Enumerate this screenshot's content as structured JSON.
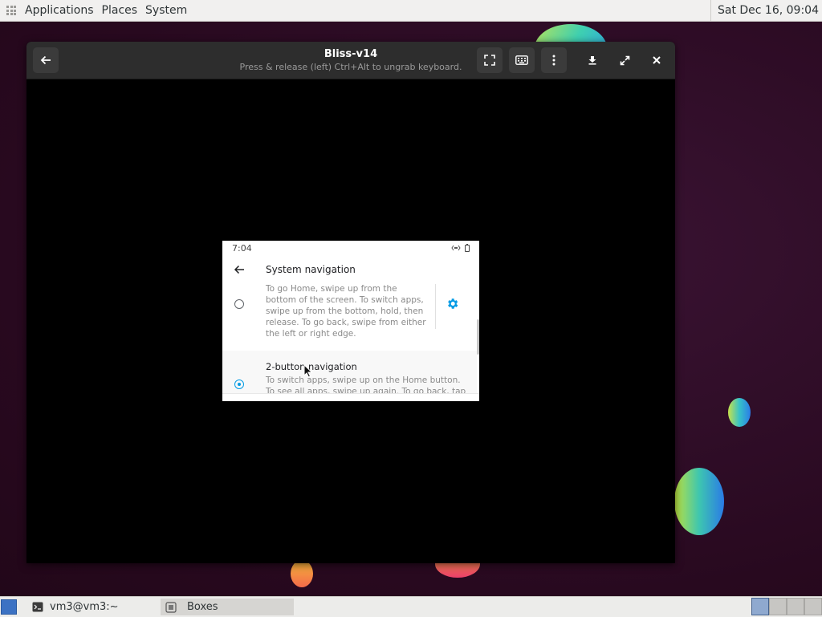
{
  "top_panel": {
    "menus": [
      "Applications",
      "Places",
      "System"
    ],
    "clock": "Sat Dec 16, 09:04"
  },
  "window": {
    "title": "Bliss-v14",
    "subtitle": "Press & release (left) Ctrl+Alt to ungrab keyboard.",
    "icons": {
      "back": "back-arrow-icon",
      "fullscreen": "fullscreen-icon",
      "keyboard": "keyboard-icon",
      "menu": "kebab-menu-icon",
      "minimize": "minimize-icon",
      "maximize": "maximize-icon",
      "close": "close-icon"
    }
  },
  "android": {
    "status_time": "7:04",
    "page_title": "System navigation",
    "option1": {
      "description": [
        "To go Home, swipe up from the",
        "bottom of the screen. To switch apps,",
        "swipe up from the bottom, hold, then",
        "release. To go back, swipe from either",
        "the left or right edge."
      ],
      "selected": false
    },
    "option2": {
      "title": "2-button navigation",
      "description": [
        "To switch apps, swipe up on the Home button.",
        "To see all apps, swipe up again. To go back, tap"
      ],
      "selected": true
    },
    "accent_color": "#039be5"
  },
  "taskbar": {
    "tasks": [
      {
        "label": "vm3@vm3:~",
        "icon": "terminal-icon"
      },
      {
        "label": "Boxes",
        "icon": "boxes-icon"
      }
    ]
  }
}
